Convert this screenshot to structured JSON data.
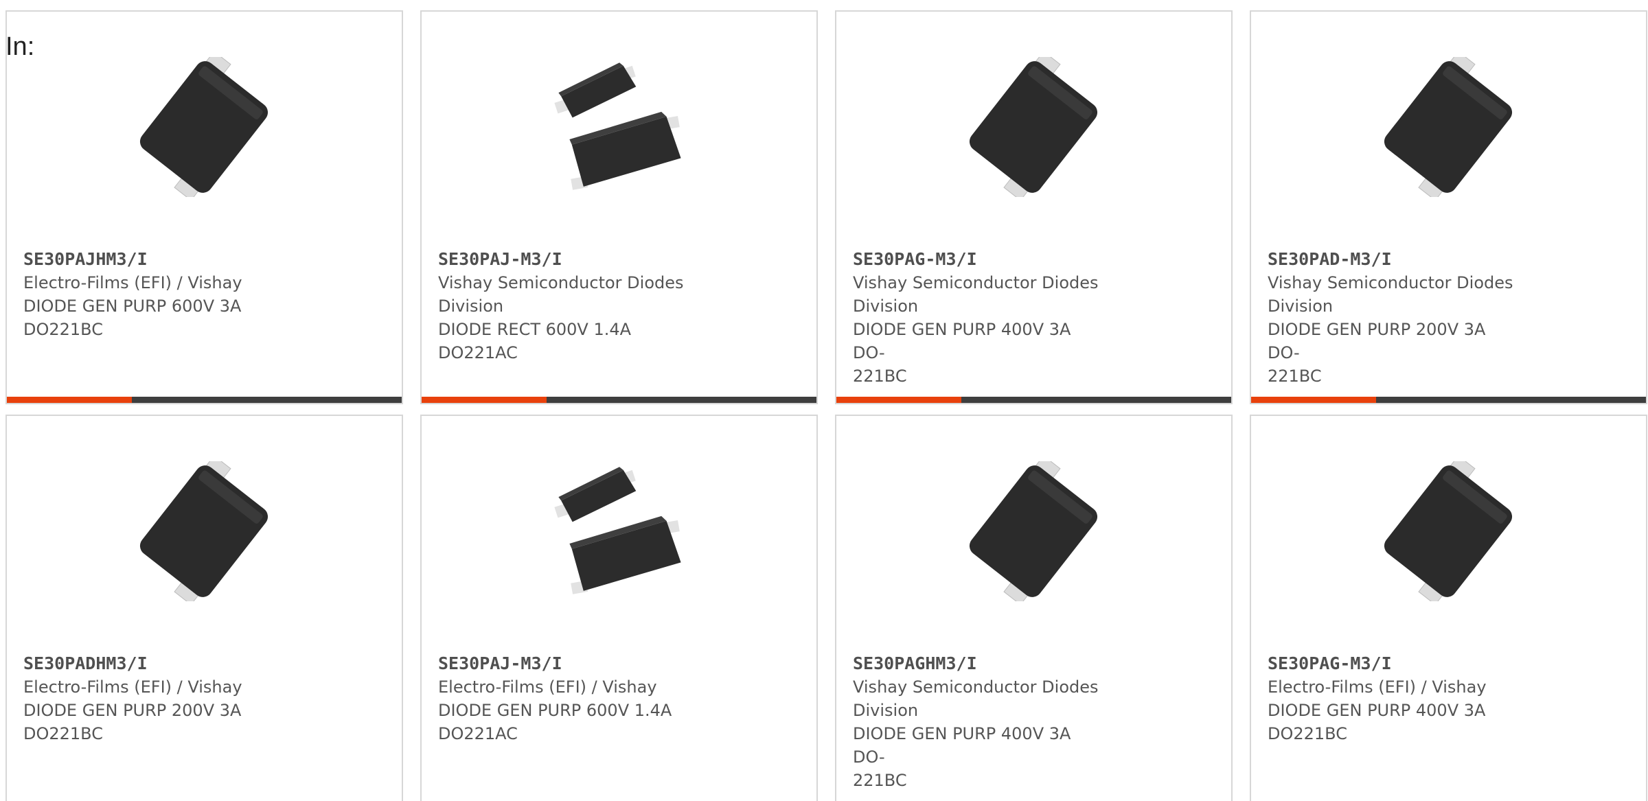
{
  "colors": {
    "accent": "#e8410c",
    "bar": "#3e3e3e",
    "border": "#d7d7d7",
    "text": "#555555"
  },
  "in_label": "In:",
  "products": [
    {
      "part": "SE30PAJHM3/I",
      "lines": [
        "Electro-Films (EFI) / Vishay",
        "DIODE GEN PURP 600V 3A",
        "DO221BC"
      ],
      "image_icon": "diode-smd-package-icon",
      "image_variant": "single"
    },
    {
      "part": "SE30PAJ-M3/I",
      "lines": [
        "Vishay Semiconductor Diodes",
        "Division",
        "DIODE RECT 600V 1.4A DO221AC"
      ],
      "image_icon": "diode-smd-pair-icon",
      "image_variant": "pair"
    },
    {
      "part": "SE30PAG-M3/I",
      "lines": [
        "Vishay Semiconductor Diodes",
        "Division",
        "DIODE GEN PURP 400V 3A DO-",
        "221BC"
      ],
      "image_icon": "diode-smd-package-icon",
      "image_variant": "single"
    },
    {
      "part": "SE30PAD-M3/I",
      "lines": [
        "Vishay Semiconductor Diodes",
        "Division",
        "DIODE GEN PURP 200V 3A DO-",
        "221BC"
      ],
      "image_icon": "diode-smd-package-icon",
      "image_variant": "single"
    },
    {
      "part": "SE30PADHM3/I",
      "lines": [
        "Electro-Films (EFI) / Vishay",
        "DIODE GEN PURP 200V 3A",
        "DO221BC"
      ],
      "image_icon": "diode-smd-package-icon",
      "image_variant": "single"
    },
    {
      "part": "SE30PAJ-M3/I",
      "lines": [
        "Electro-Films (EFI) / Vishay",
        "DIODE GEN PURP 600V 1.4A",
        "DO221AC"
      ],
      "image_icon": "diode-smd-pair-icon",
      "image_variant": "pair"
    },
    {
      "part": "SE30PAGHM3/I",
      "lines": [
        "Vishay Semiconductor Diodes",
        "Division",
        "DIODE GEN PURP 400V 3A DO-",
        "221BC"
      ],
      "image_icon": "diode-smd-package-icon",
      "image_variant": "single"
    },
    {
      "part": "SE30PAG-M3/I",
      "lines": [
        "Electro-Films (EFI) / Vishay",
        "DIODE GEN PURP 400V 3A",
        "DO221BC"
      ],
      "image_icon": "diode-smd-package-icon",
      "image_variant": "single"
    }
  ]
}
